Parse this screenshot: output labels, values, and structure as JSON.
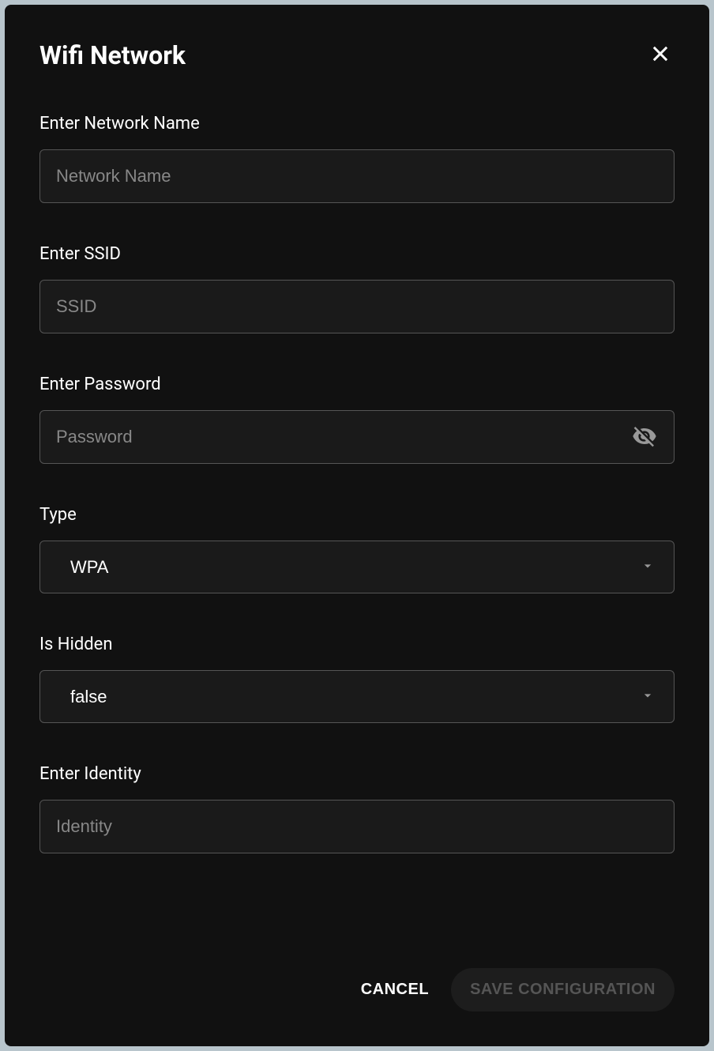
{
  "dialog": {
    "title": "Wifi Network"
  },
  "form": {
    "networkName": {
      "label": "Enter Network Name",
      "placeholder": "Network Name",
      "value": ""
    },
    "ssid": {
      "label": "Enter SSID",
      "placeholder": "SSID",
      "value": ""
    },
    "password": {
      "label": "Enter Password",
      "placeholder": "Password",
      "value": ""
    },
    "type": {
      "label": "Type",
      "value": "WPA"
    },
    "isHidden": {
      "label": "Is Hidden",
      "value": "false"
    },
    "identity": {
      "label": "Enter Identity",
      "placeholder": "Identity",
      "value": ""
    }
  },
  "footer": {
    "cancel": "CANCEL",
    "save": "SAVE CONFIGURATION"
  }
}
